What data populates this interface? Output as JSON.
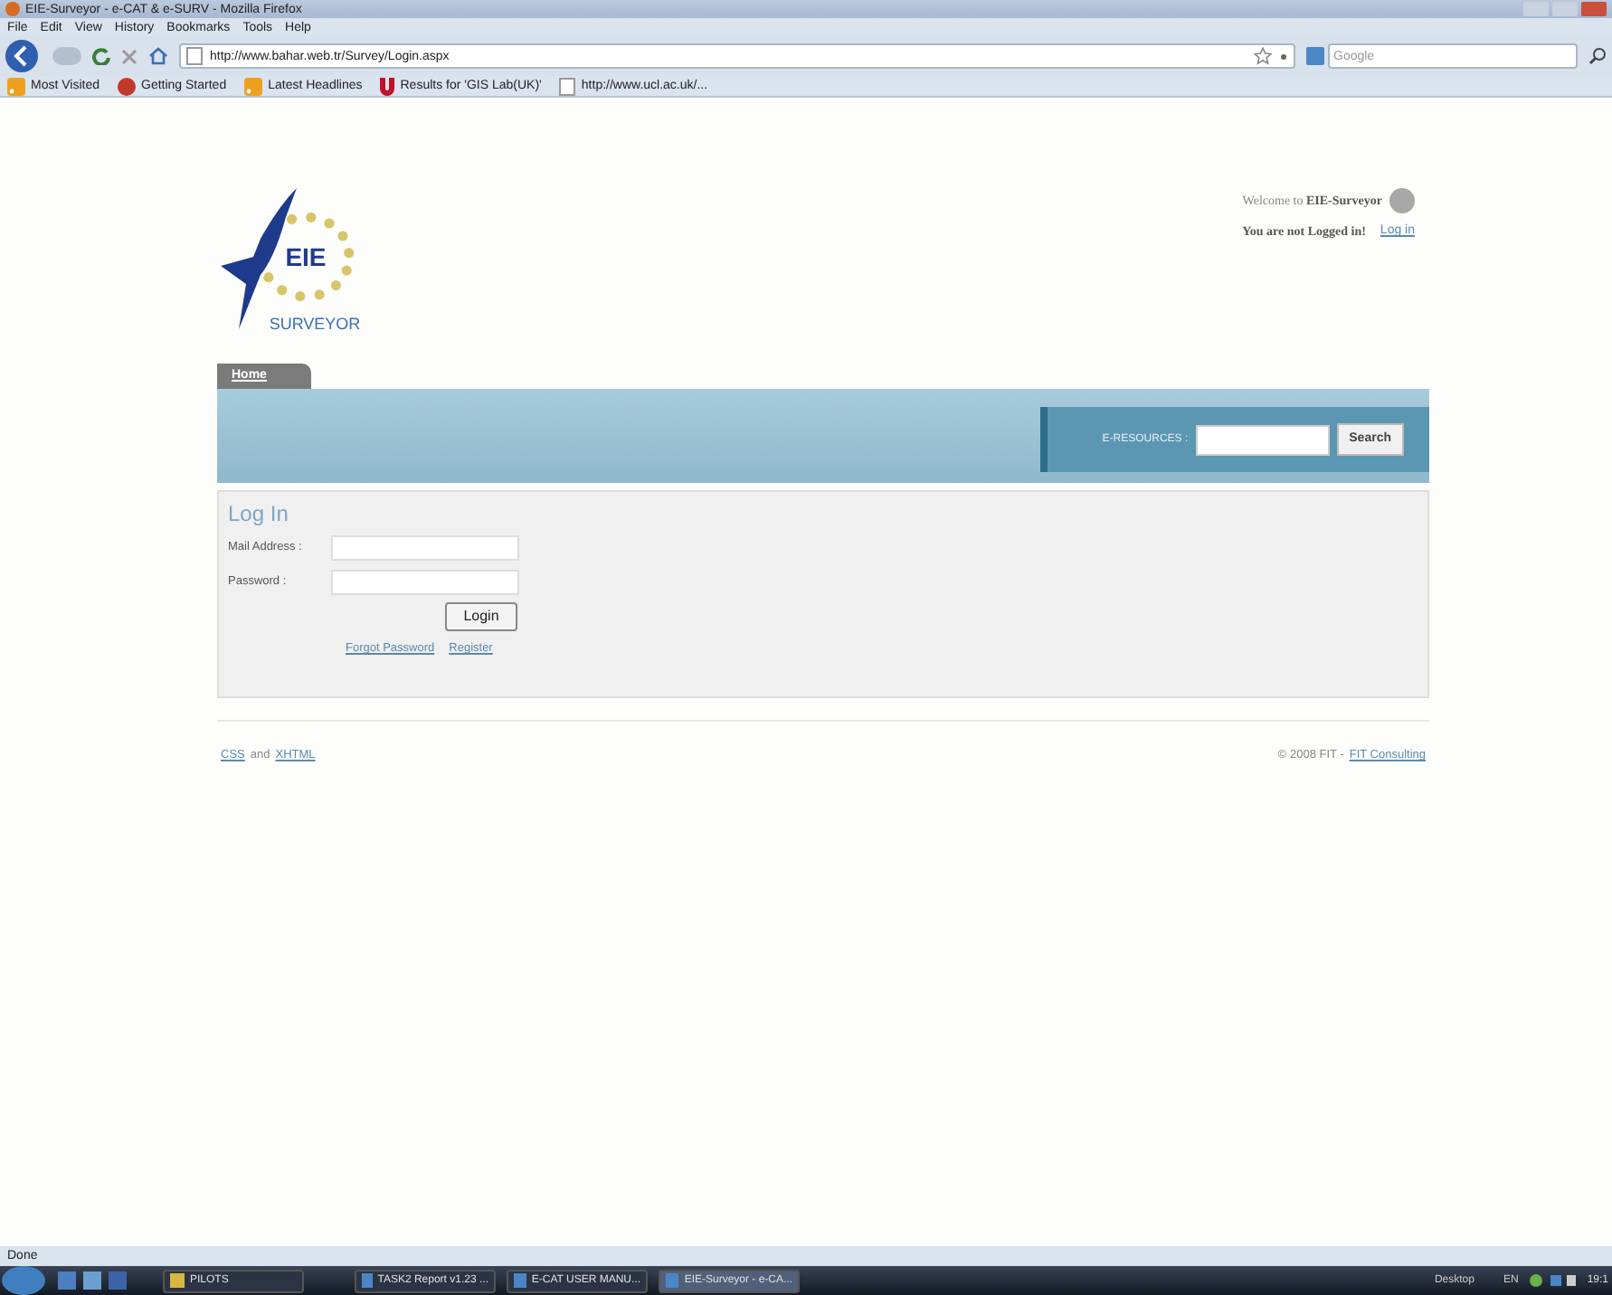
{
  "window": {
    "title": "EIE-Surveyor - e-CAT & e-SURV - Mozilla Firefox"
  },
  "menu": [
    "File",
    "Edit",
    "View",
    "History",
    "Bookmarks",
    "Tools",
    "Help"
  ],
  "address": {
    "value": "http://www.bahar.web.tr/Survey/Login.aspx"
  },
  "search": {
    "placeholder": "Google"
  },
  "bookmarks": [
    {
      "label": "Most Visited",
      "kind": "rss"
    },
    {
      "label": "Getting Started",
      "kind": "fox"
    },
    {
      "label": "Latest Headlines",
      "kind": "rss"
    },
    {
      "label": "Results for 'GIS Lab(UK)'",
      "kind": "u"
    },
    {
      "label": "http://www.ucl.ac.uk/...",
      "kind": "page"
    }
  ],
  "logo": {
    "mark": "EIE",
    "word": "SURVEYOR"
  },
  "header": {
    "welcome": "Welcome to",
    "site": "EIE-Surveyor",
    "status": "You are not Logged in!",
    "login_link": "Log in"
  },
  "tabs": [
    {
      "label": "Home",
      "selected": true
    }
  ],
  "resources": {
    "label": "E-RESOURCES :",
    "button": "Search"
  },
  "login": {
    "title": "Log In",
    "fields": [
      {
        "label": "Mail Address :"
      },
      {
        "label": "Password :"
      }
    ],
    "button": "Login",
    "links": [
      "Forgot Password",
      "Register"
    ]
  },
  "footer": {
    "left": [
      {
        "text": "CSS",
        "kind": "link"
      },
      {
        "text": "and",
        "kind": "text"
      },
      {
        "text": "XHTML",
        "kind": "link"
      }
    ],
    "right": [
      {
        "text": "© 2008 FIT -",
        "kind": "text"
      },
      {
        "text": "FIT Consulting",
        "kind": "link"
      }
    ]
  },
  "status_bar": {
    "text": "Done"
  },
  "taskbar": {
    "items": [
      {
        "label": "PILOTS",
        "selected": false
      },
      {
        "label": "TASK2 Report v1.23 ...",
        "selected": false
      },
      {
        "label": "E-CAT USER MANU...",
        "selected": false
      },
      {
        "label": "EIE-Surveyor - e-CA...",
        "selected": true
      }
    ],
    "desktop": "Desktop",
    "lang": "EN",
    "clock": "19:1"
  }
}
